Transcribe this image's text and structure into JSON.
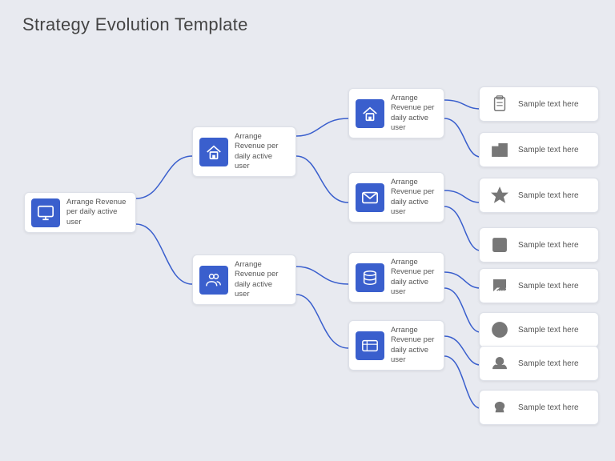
{
  "page": {
    "title": "Strategy Evolution Template",
    "bg_color": "#e8eaf0",
    "accent_color": "#3a5fcd"
  },
  "nodes": {
    "root": {
      "label": "Arrange Revenue per daily active user",
      "id": "root"
    },
    "mid1": {
      "label": "Arrange Revenue per daily active user",
      "id": "mid1"
    },
    "mid2": {
      "label": "Arrange Revenue per daily active user",
      "id": "mid2"
    },
    "branch1": {
      "label": "Arrange Revenue per daily active user",
      "id": "branch1"
    },
    "branch2": {
      "label": "Arrange Revenue per daily active user",
      "id": "branch2"
    },
    "branch3": {
      "label": "Arrange Revenue per daily active user",
      "id": "branch3"
    },
    "branch4": {
      "label": "Arrange Revenue per daily active user",
      "id": "branch4"
    }
  },
  "leaves": [
    {
      "id": "leaf1",
      "text": "Sample text here"
    },
    {
      "id": "leaf2",
      "text": "Sample text here"
    },
    {
      "id": "leaf3",
      "text": "Sample text here"
    },
    {
      "id": "leaf4",
      "text": "Sample text here"
    },
    {
      "id": "leaf5",
      "text": "Sample text here"
    },
    {
      "id": "leaf6",
      "text": "Sample text here"
    },
    {
      "id": "leaf7",
      "text": "Sample text here"
    },
    {
      "id": "leaf8",
      "text": "Sample text here"
    }
  ]
}
